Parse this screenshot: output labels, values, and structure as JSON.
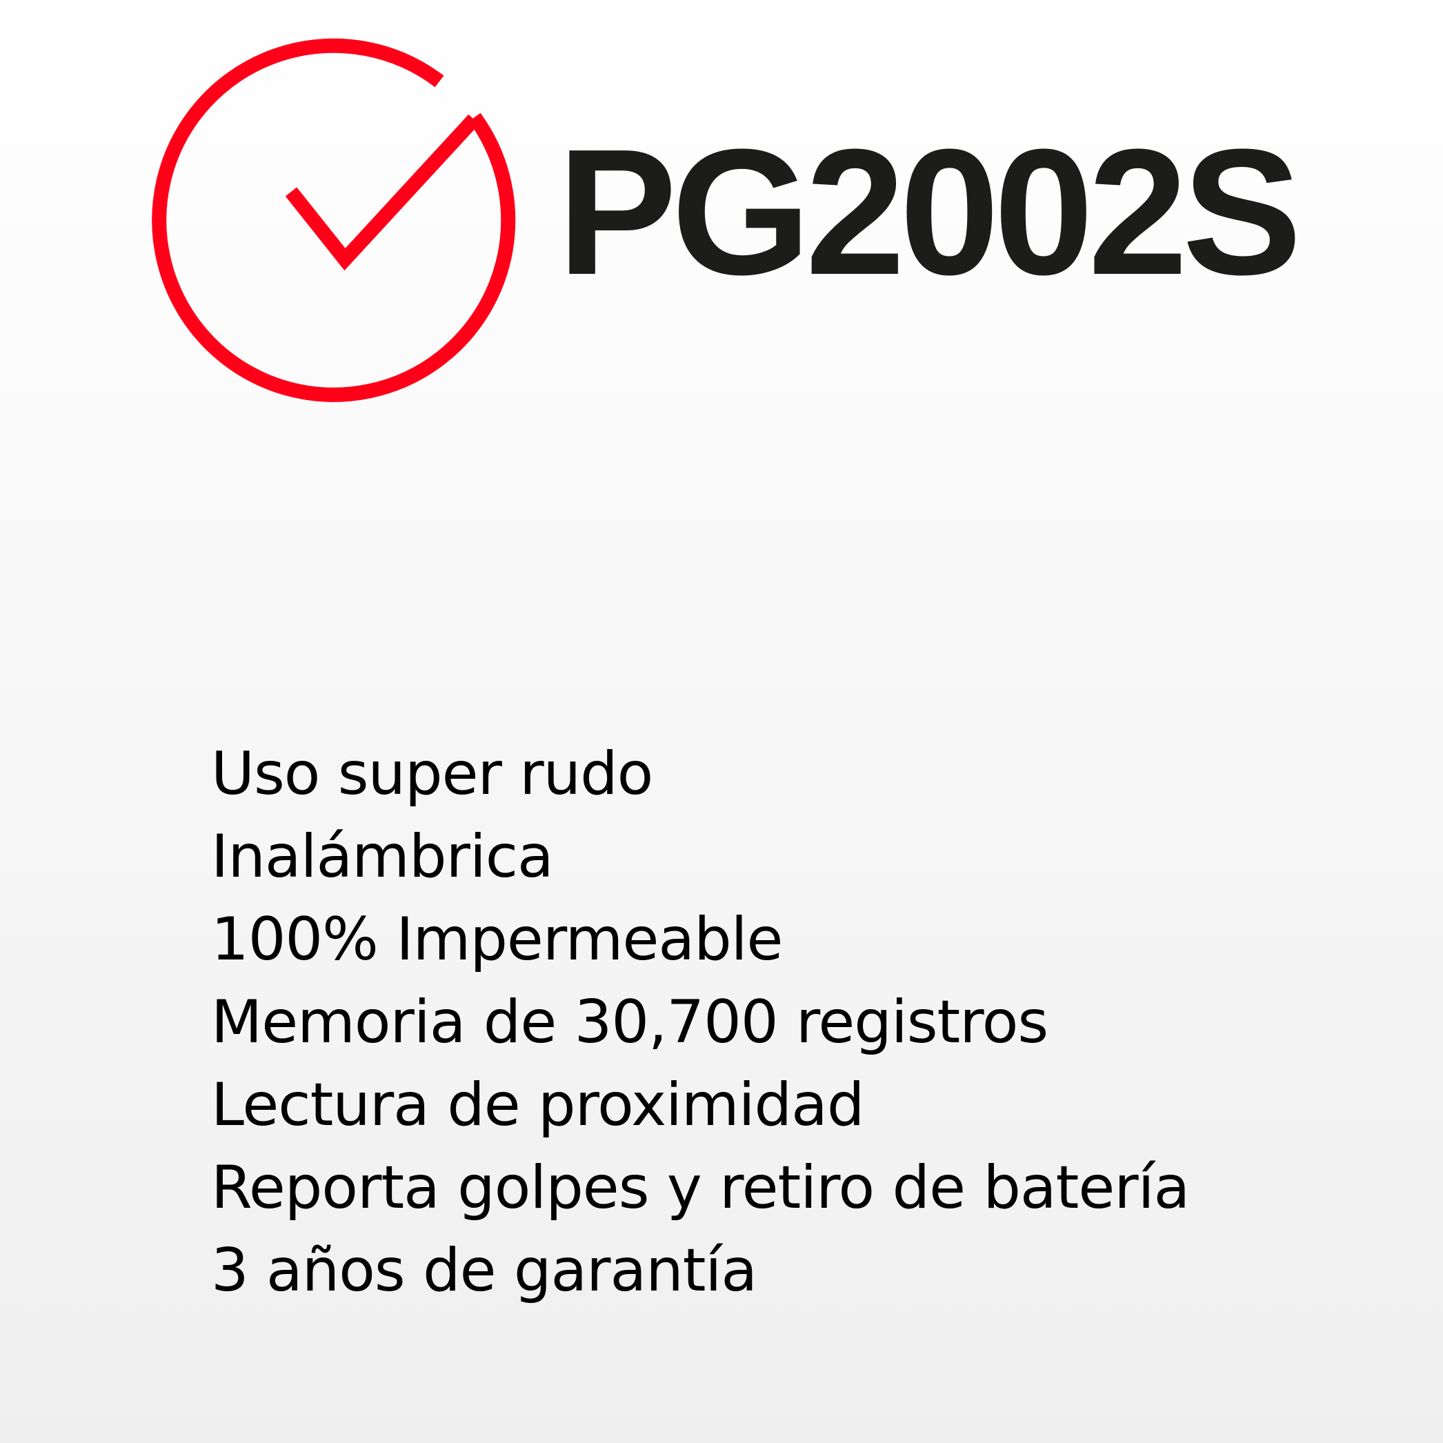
{
  "brand": {
    "model_name": "PG2002S",
    "logo_icon": "checkmark-circle-icon",
    "accent_color": "#ff0019",
    "text_color": "#1c1c1a"
  },
  "features": [
    "Uso super rudo",
    "Inalámbrica",
    "100% Impermeable",
    "Memoria de 30,700 registros",
    "Lectura de proximidad",
    "Reporta golpes y retiro de batería",
    "3 años de garantía"
  ]
}
